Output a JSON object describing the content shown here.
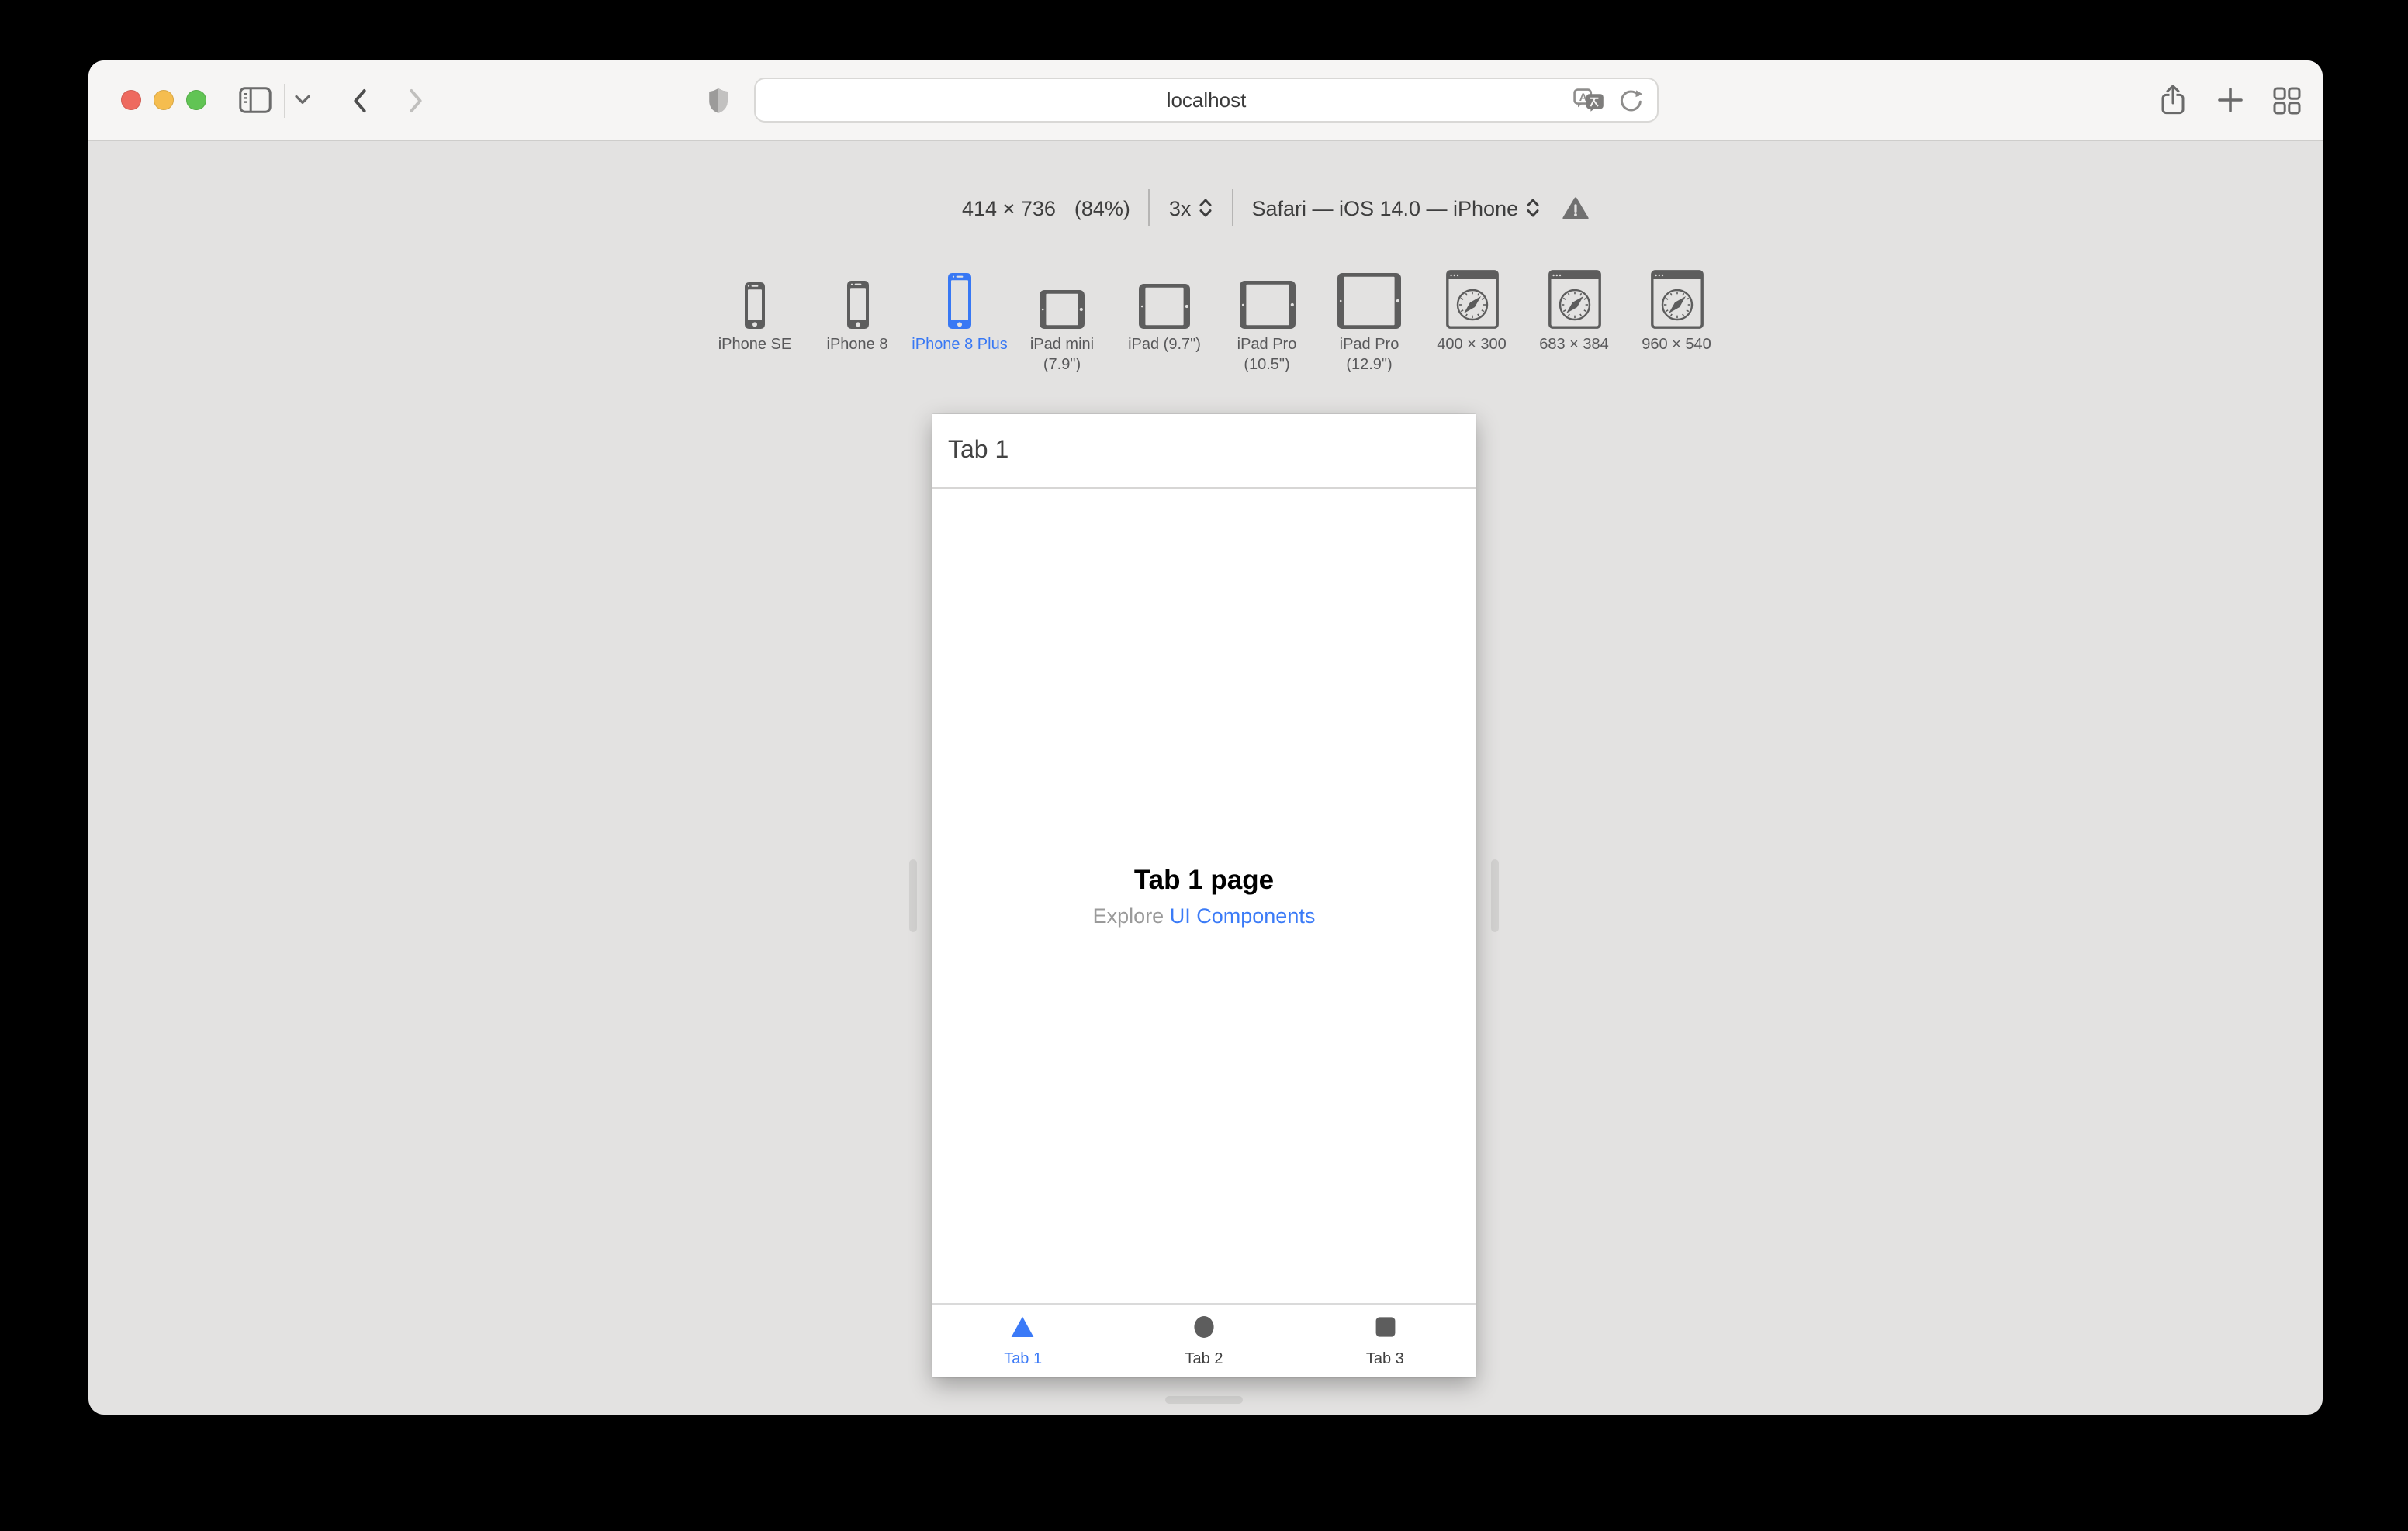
{
  "toolbar": {
    "url": "localhost",
    "icon_names": [
      "sidebar",
      "chevron-down",
      "back",
      "forward",
      "privacy-shield",
      "translate",
      "reload",
      "share",
      "new-tab",
      "tab-overview"
    ]
  },
  "rdm": {
    "dimensions": "414 × 736",
    "zoom": "(84%)",
    "pixel_ratio": "3x",
    "user_agent": "Safari — iOS 14.0 — iPhone",
    "devices": [
      {
        "id": "iphone-se",
        "label": "iPhone SE",
        "icon": "phone",
        "selected": false
      },
      {
        "id": "iphone-8",
        "label": "iPhone 8",
        "icon": "phone",
        "selected": false
      },
      {
        "id": "iphone-8-plus",
        "label": "iPhone 8 Plus",
        "icon": "phone",
        "selected": true
      },
      {
        "id": "ipad-mini",
        "label": "iPad mini (7.9\")",
        "icon": "tablet",
        "selected": false
      },
      {
        "id": "ipad-97",
        "label": "iPad (9.7\")",
        "icon": "tablet",
        "selected": false
      },
      {
        "id": "ipad-pro-105",
        "label": "iPad Pro (10.5\")",
        "icon": "tablet",
        "selected": false
      },
      {
        "id": "ipad-pro-129",
        "label": "iPad Pro (12.9\")",
        "icon": "tablet",
        "selected": false
      },
      {
        "id": "custom-400x300",
        "label": "400 × 300",
        "icon": "browser",
        "selected": false
      },
      {
        "id": "custom-683x384",
        "label": "683 × 384",
        "icon": "browser",
        "selected": false
      },
      {
        "id": "custom-960x540",
        "label": "960 × 540",
        "icon": "browser",
        "selected": false
      }
    ]
  },
  "phone": {
    "header_title": "Tab 1",
    "heading": "Tab 1 page",
    "explore_text": "Explore",
    "explore_link": "UI Components",
    "tabs": [
      {
        "label": "Tab 1",
        "icon": "triangle",
        "active": true
      },
      {
        "label": "Tab 2",
        "icon": "circle",
        "active": false
      },
      {
        "label": "Tab 3",
        "icon": "square",
        "active": false
      }
    ]
  },
  "colors": {
    "device_accent": "#3878f4",
    "device_gray": "#5d5d5d",
    "canvas_gray": "#e3e2e1",
    "link_blue": "#3b7bf7",
    "tab_active": "#3b7af7",
    "tab_inactive_icon": "#5d5d5d",
    "traffic_red": "#ee6a5f",
    "traffic_yellow": "#f5bd4f",
    "traffic_green": "#61c454"
  }
}
